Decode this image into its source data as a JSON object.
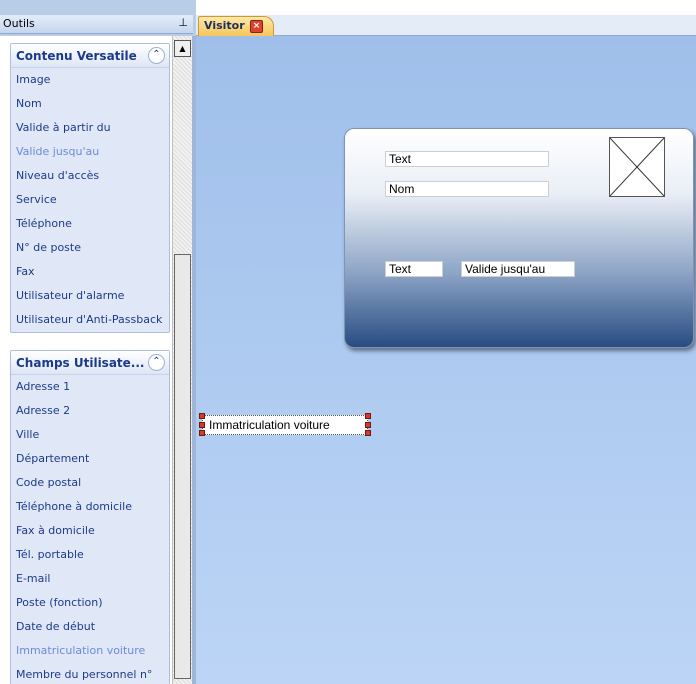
{
  "tools_panel": {
    "title": "Outils",
    "pin_icon": "pin-icon"
  },
  "groups": [
    {
      "title": "Contenu Versatile",
      "items": [
        {
          "label": "Image"
        },
        {
          "label": "Nom"
        },
        {
          "label": "Valide à partir du"
        },
        {
          "label": "Valide jusqu'au",
          "muted": true
        },
        {
          "label": "Niveau d'accès"
        },
        {
          "label": "Service"
        },
        {
          "label": "Téléphone"
        },
        {
          "label": "N° de poste"
        },
        {
          "label": "Fax"
        },
        {
          "label": "Utilisateur d'alarme"
        },
        {
          "label": "Utilisateur d'Anti-Passback"
        }
      ]
    },
    {
      "title": "Champs Utilisate...",
      "items": [
        {
          "label": "Adresse 1"
        },
        {
          "label": "Adresse 2"
        },
        {
          "label": "Ville"
        },
        {
          "label": "Département"
        },
        {
          "label": "Code postal"
        },
        {
          "label": "Téléphone à domicile"
        },
        {
          "label": "Fax à domicile"
        },
        {
          "label": "Tél. portable"
        },
        {
          "label": "E-mail"
        },
        {
          "label": "Poste (fonction)"
        },
        {
          "label": "Date de début"
        },
        {
          "label": "Immatriculation voiture",
          "muted": true
        },
        {
          "label": "Membre du personnel n°"
        }
      ]
    }
  ],
  "tab": {
    "label": "Visitor",
    "close_icon": "close-icon"
  },
  "card": {
    "field_text_1": "Text",
    "field_nom": "Nom",
    "field_text_2": "Text",
    "field_valide": "Valide jusqu'au",
    "photo_icon": "image-placeholder-icon"
  },
  "free_field": {
    "label": "Immatriculation voiture"
  }
}
